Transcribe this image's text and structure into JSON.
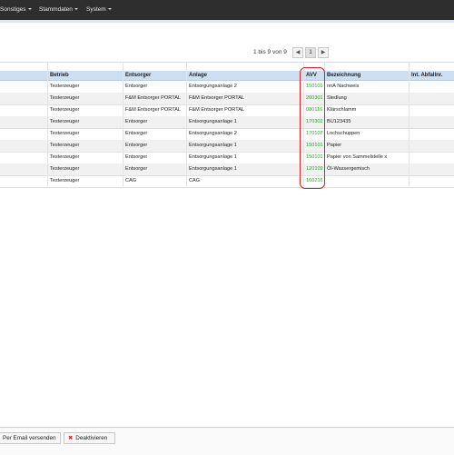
{
  "menu": {
    "items": [
      {
        "label": "Sonstiges"
      },
      {
        "label": "Stammdaten"
      },
      {
        "label": "System"
      }
    ]
  },
  "pagination": {
    "summary": "1 bis 9 von 9",
    "prev_icon": "chevron-left-icon",
    "page": "1",
    "next_icon": "chevron-right-icon"
  },
  "table": {
    "columns": [
      "Betrieb",
      "Entsorger",
      "Anlage",
      "AVV",
      "Bezeichnung",
      "Int. Abfallnr."
    ],
    "rows": [
      [
        "Testerzeuger",
        "Entsorger",
        "Entsorgungsanlage 2",
        "150101",
        "nnA Nachweis",
        ""
      ],
      [
        "Testerzeuger",
        "F&M Entsorger PORTAL",
        "F&M Entsorger PORTAL",
        "200301",
        "Siedlung",
        ""
      ],
      [
        "Testerzeuger",
        "F&M Entsorger PORTAL",
        "F&M Entsorger PORTAL",
        "080116",
        "Klärschlamm",
        ""
      ],
      [
        "Testerzeuger",
        "Entsorger",
        "Entsorgungsanlage 1",
        "170302",
        "BU123435",
        ""
      ],
      [
        "Testerzeuger",
        "Entsorger",
        "Entsorgungsanlage 2",
        "170107",
        "Lochschuppen",
        ""
      ],
      [
        "Testerzeuger",
        "Entsorger",
        "Entsorgungsanlage 1",
        "150101",
        "Papier",
        ""
      ],
      [
        "Testerzeuger",
        "Entsorger",
        "Entsorgungsanlage 1",
        "150101",
        "Papier von Sammelstelle x",
        ""
      ],
      [
        "Testerzeuger",
        "Entsorger",
        "Entsorgungsanlage 1",
        "120109",
        "Öl-Wassergemisch",
        ""
      ],
      [
        "Testerzeuger",
        "CAG",
        "CAG",
        "160216",
        "",
        ""
      ]
    ]
  },
  "footer": {
    "email_label": "Per Email versenden",
    "deactivate_label": "Deaktivieren",
    "deactivate_icon": "close-icon"
  },
  "colors": {
    "topbar": "#2e2e2e",
    "header": "#cde0f3",
    "avv_text": "#27a327",
    "highlight": "#d6232a"
  }
}
